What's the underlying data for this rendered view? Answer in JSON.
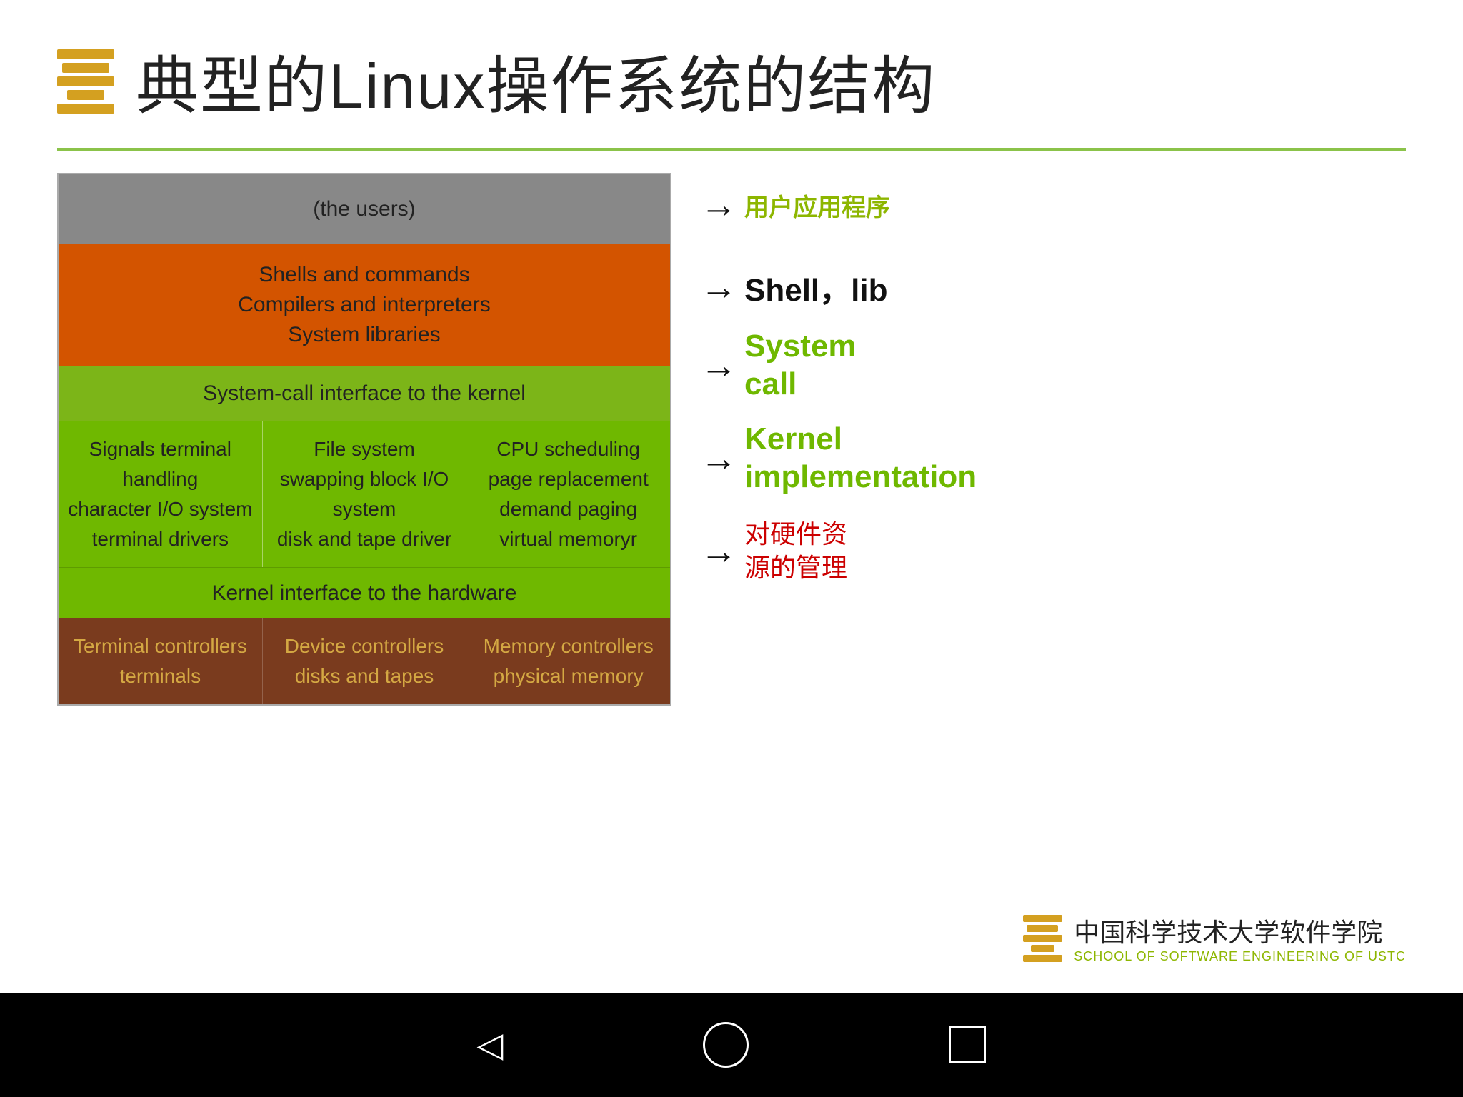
{
  "header": {
    "title": "典型的Linux操作系统的结构"
  },
  "diagram": {
    "users_layer": "(the users)",
    "orange_layer": {
      "line1": "Shells and commands",
      "line2": "Compilers and interpreters",
      "line3": "System libraries"
    },
    "syscall_layer": "System-call interface to the kernel",
    "kernel_cols": [
      {
        "lines": [
          "Signals terminal",
          "handling",
          "character I/O system",
          "terminal    drivers"
        ]
      },
      {
        "lines": [
          "File system",
          "swapping block I/O",
          "system",
          "disk and tape driver"
        ]
      },
      {
        "lines": [
          "CPU scheduling",
          "page replacement",
          "demand paging",
          "virtual memoryr"
        ]
      }
    ],
    "hw_interface": "Kernel interface to the hardware",
    "controller_cols": [
      {
        "lines": [
          "Terminal controllers",
          "terminals"
        ]
      },
      {
        "lines": [
          "Device controllers",
          "disks and tapes"
        ]
      },
      {
        "lines": [
          "Memory controllers",
          "physical memory"
        ]
      }
    ]
  },
  "labels": {
    "users_label": "用户应用程序",
    "shell_label": "Shell，lib",
    "syscall_label_line1": "System",
    "syscall_label_line2": "call",
    "kernel_label_line1": "Kernel",
    "kernel_label_line2": "implementation",
    "hw_label_line1": "对硬件资",
    "hw_label_line2": "源的管理"
  },
  "footer": {
    "cn": "中国科学技术大学软件学院",
    "en": "SCHOOL OF SOFTWARE ENGINEERING OF USTC"
  },
  "nav": {
    "back": "◁",
    "home": "○",
    "recent": "□"
  }
}
